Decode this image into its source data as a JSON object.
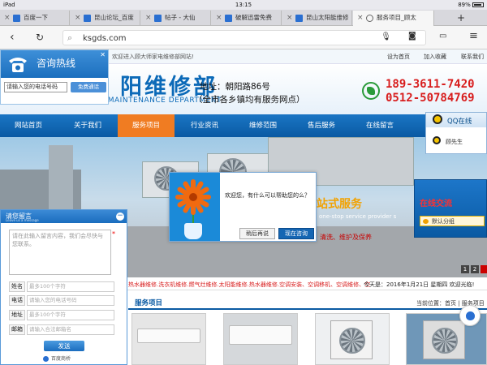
{
  "status_bar": {
    "device": "iPad",
    "time": "13:15",
    "battery": "89%"
  },
  "tabs": [
    {
      "title": "百度一下"
    },
    {
      "title": "昆山论坛_百度"
    },
    {
      "title": "帖子 - 大仙"
    },
    {
      "title": "破解迅雷免费"
    },
    {
      "title": "昆山太阳能维修"
    },
    {
      "title": "服务项目_顾太"
    }
  ],
  "address_bar": {
    "url": "ksgds.com"
  },
  "top_bar": {
    "intro": "欢迎进入顾大师家电维修部网站!",
    "links": [
      "设为首页",
      "加入收藏",
      "联系我们"
    ]
  },
  "header": {
    "logo_text": "阳维修部",
    "logo_en": "MASTER GU APPLIANCE MAINTENANCE DEPARTMENT",
    "address": "地址：朝阳路86号",
    "coverage": "（全市各乡镇均有服务网点）",
    "phone1": "189-3611-7420",
    "phone2": "0512-50784769"
  },
  "hotline": {
    "title": "咨询热线",
    "input_value": "请输入您的电话号码",
    "button_label": "免费通话"
  },
  "menu": [
    {
      "label": "网站首页"
    },
    {
      "label": "关于我们"
    },
    {
      "label": "服务项目"
    },
    {
      "label": "行业资讯"
    },
    {
      "label": "维修范围"
    },
    {
      "label": "售后服务"
    },
    {
      "label": "在线留言"
    }
  ],
  "qq_panel": {
    "title": "QQ在线",
    "contact": "顾先生"
  },
  "banner": {
    "headline": "一站式服务",
    "subline": "one-stop service provider s",
    "tagline": "清洗、维护及保养",
    "pages": [
      "1",
      "2"
    ]
  },
  "online_chat": {
    "title": "在线交流",
    "group": "默认分组"
  },
  "chat_popup": {
    "message": "欢迎您，有什么可以帮助您的么？",
    "later_label": "稍后再说",
    "now_label": "现在咨询"
  },
  "marquee": {
    "text": "热水器维修.洗衣机维修.燃气灶维修.太阳能维修.热水器维修.空调安装、空调移机、空调维修、空",
    "date": "今天是：2016年1月21日 星期四 欢迎光临!"
  },
  "services": {
    "title": "服务项目",
    "breadcrumb": "当前位置：首页 | 服务项目"
  },
  "message_form": {
    "title": "请您留言",
    "subtitle": "Leave us a message",
    "textarea_placeholder": "请在此输入留言内容，我们会尽快与您联系。",
    "fields": [
      {
        "label": "姓名",
        "placeholder": "最多100个字符"
      },
      {
        "label": "电话",
        "placeholder": "请输入您的电话号码"
      },
      {
        "label": "地址",
        "placeholder": "最多100个字符"
      },
      {
        "label": "邮箱",
        "placeholder": "请输入合法邮箱名"
      }
    ],
    "send_label": "发送",
    "share_label": "百度商桥"
  },
  "colors": {
    "brand_blue": "#0a5aa3",
    "active_orange": "#f07c22",
    "phone_red": "#d81e1e"
  }
}
